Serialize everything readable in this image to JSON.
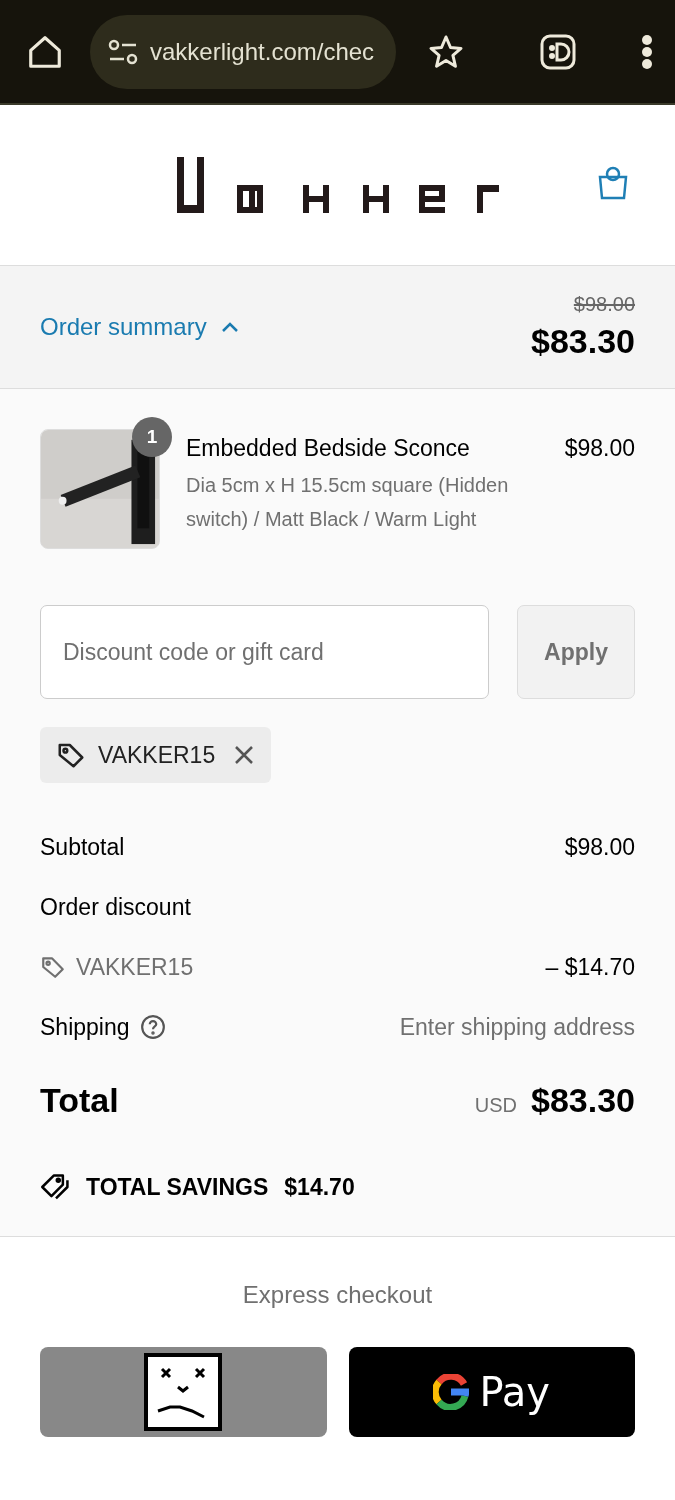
{
  "browser": {
    "url": "vakkerlight.com/chec"
  },
  "summary_bar": {
    "label": "Order summary",
    "expanded": true,
    "original_price": "$98.00",
    "price": "$83.30"
  },
  "items": [
    {
      "quantity": "1",
      "name": "Embedded Bedside Sconce",
      "variant": "Dia 5cm x H 15.5cm square (Hidden switch) / Matt Black / Warm Light",
      "price": "$98.00"
    }
  ],
  "discount": {
    "placeholder": "Discount code or gift card",
    "button": "Apply",
    "applied_code": "VAKKER15"
  },
  "totals": {
    "subtotal_label": "Subtotal",
    "subtotal": "$98.00",
    "discount_label": "Order discount",
    "discount_code": "VAKKER15",
    "discount_amount": "– $14.70",
    "shipping_label": "Shipping",
    "shipping_value": "Enter shipping address",
    "total_label": "Total",
    "currency": "USD",
    "total": "$83.30"
  },
  "savings": {
    "label": "TOTAL SAVINGS",
    "amount": "$14.70"
  },
  "express": {
    "title": "Express checkout",
    "buttons": [
      {
        "kind": "broken"
      },
      {
        "kind": "gpay",
        "label": "Pay"
      }
    ]
  }
}
